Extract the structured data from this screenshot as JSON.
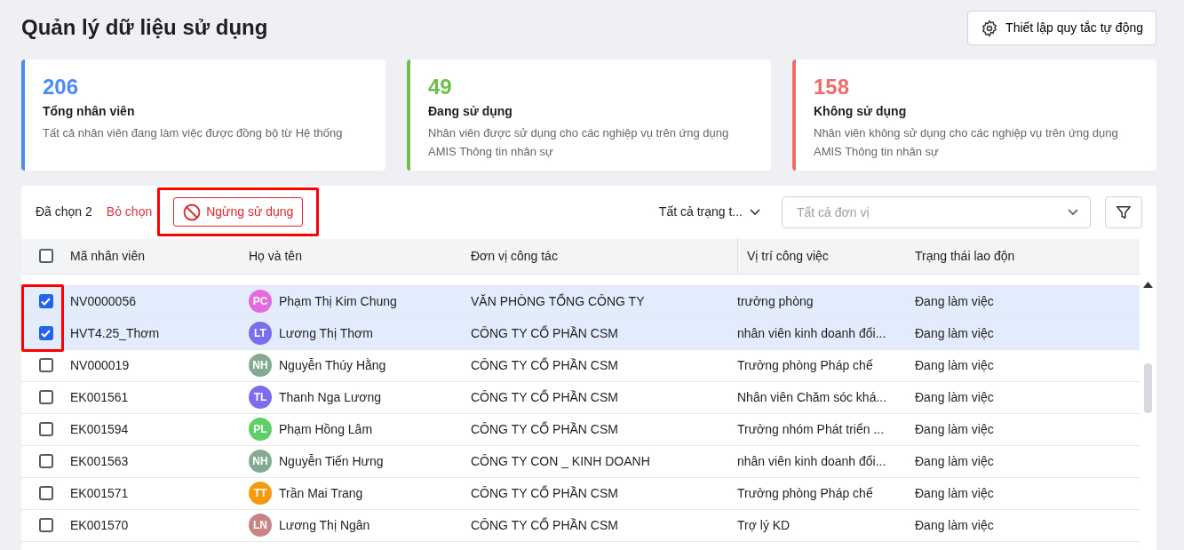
{
  "page": {
    "title": "Quản lý dữ liệu sử dụng",
    "settings_button": "Thiết lập quy tắc tự động"
  },
  "summary_cards": [
    {
      "count": "206",
      "title": "Tổng nhân viên",
      "description": "Tất cả nhân viên đang làm việc được đồng bộ từ Hệ thống",
      "color": "#4a8af4"
    },
    {
      "count": "49",
      "title": "Đang sử dụng",
      "description": "Nhân viên được sử dụng cho các nghiệp vụ trên ứng dụng AMIS Thông tin nhân sự",
      "color": "#6cc04a"
    },
    {
      "count": "158",
      "title": "Không sử dụng",
      "description": "Nhân viên không sử dụng cho các nghiệp vụ trên ứng dụng AMIS Thông tin nhân sự",
      "color": "#f26b6b"
    }
  ],
  "toolbar": {
    "selected_label": "Đã chọn 2",
    "clear_link": "Bỏ chọn",
    "stop_button": "Ngừng sử dụng",
    "stop_button_highlighted": true,
    "status_filter": "Tất cả trạng t...",
    "unit_filter": {
      "placeholder": "Tất cả đơn vị"
    }
  },
  "table": {
    "select_all_checked": false,
    "selection_highlighted": true,
    "columns": [
      "Mã nhân viên",
      "Họ và tên",
      "Đơn vị công tác",
      "Vị trí công việc",
      "Trạng thái lao độn"
    ],
    "rows": [
      {
        "selected": true,
        "code": "NV0000056",
        "initials": "PC",
        "color": "#e46ae0",
        "name": "Phạm Thị Kim Chung",
        "unit": "VĂN PHÒNG TỔNG CÔNG TY",
        "position": "trưởng phòng",
        "status": "Đang làm việc"
      },
      {
        "selected": true,
        "code": "HVT4.25_Thơm",
        "initials": "LT",
        "color": "#7b6cf0",
        "name": "Lương Thị Thơm",
        "unit": "CÔNG TY CỔ PHẦN CSM",
        "position": "nhân viên kinh doanh đổi...",
        "status": "Đang làm việc"
      },
      {
        "selected": false,
        "code": "NV000019",
        "initials": "NH",
        "color": "#82ac92",
        "name": "Nguyễn Thúy Hằng",
        "unit": "CÔNG TY CỔ PHẦN CSM",
        "position": "Trưởng phòng Pháp chế",
        "status": "Đang làm việc"
      },
      {
        "selected": false,
        "code": "EK001561",
        "initials": "TL",
        "color": "#7b6cf0",
        "name": "Thanh Nga Lương",
        "unit": "CÔNG TY CỔ PHẦN CSM",
        "position": "Nhân viên Chăm sóc khá...",
        "status": "Đang làm việc"
      },
      {
        "selected": false,
        "code": "EK001594",
        "initials": "PL",
        "color": "#5fcf6a",
        "name": "Phạm Hồng Lâm",
        "unit": "CÔNG TY CỔ PHẦN CSM",
        "position": "Trưởng nhóm Phát triển ...",
        "status": "Đang làm việc"
      },
      {
        "selected": false,
        "code": "EK001563",
        "initials": "NH",
        "color": "#82ac92",
        "name": "Nguyễn Tiến Hưng",
        "unit": "CÔNG TY CON _ KINH DOANH",
        "position": "nhân viên kinh doanh đổi...",
        "status": "Đang làm việc"
      },
      {
        "selected": false,
        "code": "EK001571",
        "initials": "TT",
        "color": "#f59a0c",
        "name": "Trần Mai Trang",
        "unit": "CÔNG TY CỔ PHẦN CSM",
        "position": "Trưởng phòng Pháp chế",
        "status": "Đang làm việc"
      },
      {
        "selected": false,
        "code": "EK001570",
        "initials": "LN",
        "color": "#c98585",
        "name": "Lương Thị Ngân",
        "unit": "CÔNG TY CỔ PHẦN CSM",
        "position": "Trợ lý KD",
        "status": "Đang làm việc"
      }
    ]
  }
}
